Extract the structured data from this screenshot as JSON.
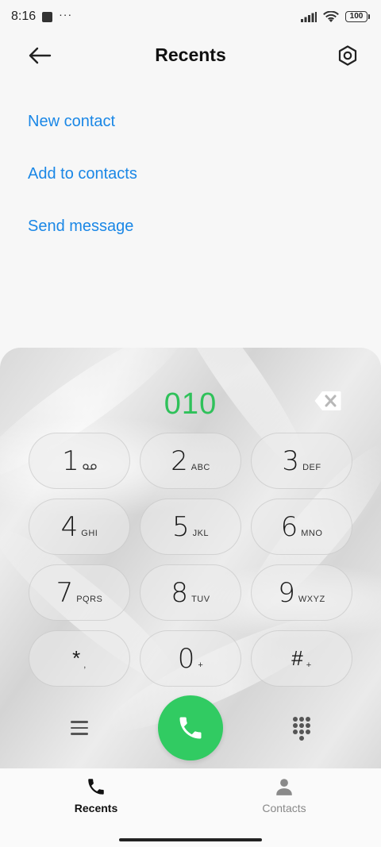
{
  "status_bar": {
    "time": "8:16",
    "battery": "100"
  },
  "header": {
    "title": "Recents"
  },
  "actions": [
    {
      "label": "New contact"
    },
    {
      "label": "Add to contacts"
    },
    {
      "label": "Send message"
    }
  ],
  "dialer": {
    "number": "010",
    "keys": [
      {
        "digit": "1",
        "letters": "",
        "icon": "voicemail-icon"
      },
      {
        "digit": "2",
        "letters": "ABC"
      },
      {
        "digit": "3",
        "letters": "DEF"
      },
      {
        "digit": "4",
        "letters": "GHI"
      },
      {
        "digit": "5",
        "letters": "JKL"
      },
      {
        "digit": "6",
        "letters": "MNO"
      },
      {
        "digit": "7",
        "letters": "PQRS"
      },
      {
        "digit": "8",
        "letters": "TUV"
      },
      {
        "digit": "9",
        "letters": "WXYZ"
      },
      {
        "digit": "*",
        "letters": ","
      },
      {
        "digit": "0",
        "letters": "+"
      },
      {
        "digit": "#",
        "letters": "+"
      }
    ],
    "call_color": "#31cb62",
    "number_color": "#2fc15a"
  },
  "nav": {
    "recents_label": "Recents",
    "contacts_label": "Contacts"
  },
  "colors": {
    "link": "#1a87e6"
  }
}
